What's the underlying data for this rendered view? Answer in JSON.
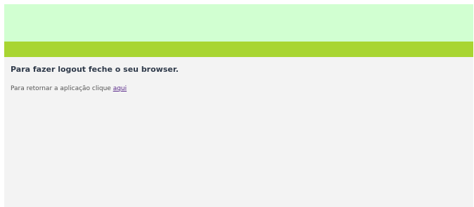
{
  "logout": {
    "heading": "Para fazer logout feche o seu browser.",
    "return_text": "Para retornar a aplicação clique ",
    "link_text": "aqui"
  },
  "colors": {
    "banner": "#d1ffd1",
    "accent_bar": "#a8d532",
    "content_bg": "#f3f3f3",
    "heading_text": "#2f3a4a",
    "link": "#5a2a8a"
  }
}
